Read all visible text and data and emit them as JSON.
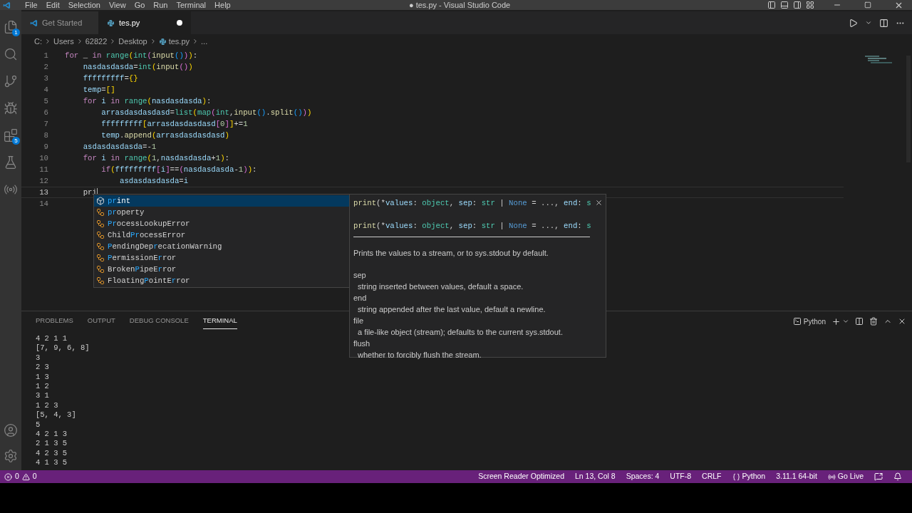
{
  "menu": [
    "File",
    "Edit",
    "Selection",
    "View",
    "Go",
    "Run",
    "Terminal",
    "Help"
  ],
  "window": {
    "title": "● tes.py - Visual Studio Code"
  },
  "activity_badges": {
    "explorer": "1",
    "extensions": "5"
  },
  "tabs": [
    {
      "label": "Get Started",
      "kind": "welcome",
      "selected": false,
      "modified": false
    },
    {
      "label": "tes.py",
      "kind": "python",
      "selected": true,
      "modified": true
    }
  ],
  "breadcrumb": [
    "C:",
    "Users",
    "62822",
    "Desktop",
    "tes.py",
    "..."
  ],
  "code_lines": [
    {
      "number": "1",
      "current": false,
      "tokens": [
        {
          "t": "for",
          "kind": "kw"
        },
        {
          "t": " _ ",
          "kind": "op"
        },
        {
          "t": "in ",
          "kind": "kw"
        },
        {
          "t": "range",
          "kind": "cls"
        },
        {
          "t": "(",
          "kind": "b1"
        },
        {
          "t": "int",
          "kind": "cls"
        },
        {
          "t": "(",
          "kind": "b2"
        },
        {
          "t": "input",
          "kind": "fn"
        },
        {
          "t": "()",
          "kind": "b3"
        },
        {
          "t": ")",
          "kind": "b2"
        },
        {
          "t": ")",
          "kind": "b1"
        },
        {
          "t": ":",
          "kind": "op"
        }
      ]
    },
    {
      "number": "2",
      "current": false,
      "tokens": [
        {
          "t": "    nasdasdasda",
          "kind": "var"
        },
        {
          "t": "=",
          "kind": "op"
        },
        {
          "t": "int",
          "kind": "cls"
        },
        {
          "t": "(",
          "kind": "b1"
        },
        {
          "t": "input",
          "kind": "fn"
        },
        {
          "t": "()",
          "kind": "b2"
        },
        {
          "t": ")",
          "kind": "b1"
        }
      ]
    },
    {
      "number": "3",
      "current": false,
      "tokens": [
        {
          "t": "    fffffffff",
          "kind": "var"
        },
        {
          "t": "=",
          "kind": "op"
        },
        {
          "t": "{}",
          "kind": "b1"
        }
      ]
    },
    {
      "number": "4",
      "current": false,
      "tokens": [
        {
          "t": "    temp",
          "kind": "var"
        },
        {
          "t": "=",
          "kind": "op"
        },
        {
          "t": "[]",
          "kind": "b1"
        }
      ]
    },
    {
      "number": "5",
      "current": false,
      "tokens": [
        {
          "t": "    for",
          "kind": "kw"
        },
        {
          "t": " i ",
          "kind": "var"
        },
        {
          "t": "in ",
          "kind": "kw"
        },
        {
          "t": "range",
          "kind": "cls"
        },
        {
          "t": "(",
          "kind": "b1"
        },
        {
          "t": "nasdasdasda",
          "kind": "var"
        },
        {
          "t": ")",
          "kind": "b1"
        },
        {
          "t": ":",
          "kind": "op"
        }
      ]
    },
    {
      "number": "6",
      "current": false,
      "tokens": [
        {
          "t": "        arrasdasdasdasd",
          "kind": "var"
        },
        {
          "t": "=",
          "kind": "op"
        },
        {
          "t": "list",
          "kind": "cls"
        },
        {
          "t": "(",
          "kind": "b1"
        },
        {
          "t": "map",
          "kind": "cls"
        },
        {
          "t": "(",
          "kind": "b2"
        },
        {
          "t": "int",
          "kind": "cls"
        },
        {
          "t": ",",
          "kind": "op"
        },
        {
          "t": "input",
          "kind": "fn"
        },
        {
          "t": "()",
          "kind": "b3"
        },
        {
          "t": ".",
          "kind": "op"
        },
        {
          "t": "split",
          "kind": "fn"
        },
        {
          "t": "()",
          "kind": "b3"
        },
        {
          "t": ")",
          "kind": "b2"
        },
        {
          "t": ")",
          "kind": "b1"
        }
      ]
    },
    {
      "number": "7",
      "current": false,
      "tokens": [
        {
          "t": "        fffffffff",
          "kind": "var"
        },
        {
          "t": "[",
          "kind": "b1"
        },
        {
          "t": "arrasdasdasdasd",
          "kind": "var"
        },
        {
          "t": "[",
          "kind": "b2"
        },
        {
          "t": "0",
          "kind": "num"
        },
        {
          "t": "]",
          "kind": "b2"
        },
        {
          "t": "]",
          "kind": "b1"
        },
        {
          "t": "+=",
          "kind": "op"
        },
        {
          "t": "1",
          "kind": "num"
        }
      ]
    },
    {
      "number": "8",
      "current": false,
      "tokens": [
        {
          "t": "        temp",
          "kind": "var"
        },
        {
          "t": ".",
          "kind": "op"
        },
        {
          "t": "append",
          "kind": "fn"
        },
        {
          "t": "(",
          "kind": "b1"
        },
        {
          "t": "arrasdasdasdasd",
          "kind": "var"
        },
        {
          "t": ")",
          "kind": "b1"
        }
      ]
    },
    {
      "number": "9",
      "current": false,
      "tokens": [
        {
          "t": "    asdasdasdasda",
          "kind": "var"
        },
        {
          "t": "=-",
          "kind": "op"
        },
        {
          "t": "1",
          "kind": "num"
        }
      ]
    },
    {
      "number": "10",
      "current": false,
      "tokens": [
        {
          "t": "    for",
          "kind": "kw"
        },
        {
          "t": " i ",
          "kind": "var"
        },
        {
          "t": "in ",
          "kind": "kw"
        },
        {
          "t": "range",
          "kind": "cls"
        },
        {
          "t": "(",
          "kind": "b1"
        },
        {
          "t": "1",
          "kind": "num"
        },
        {
          "t": ",",
          "kind": "op"
        },
        {
          "t": "nasdasdasda",
          "kind": "var"
        },
        {
          "t": "+",
          "kind": "op"
        },
        {
          "t": "1",
          "kind": "num"
        },
        {
          "t": ")",
          "kind": "b1"
        },
        {
          "t": ":",
          "kind": "op"
        }
      ]
    },
    {
      "number": "11",
      "current": false,
      "tokens": [
        {
          "t": "        if",
          "kind": "kw"
        },
        {
          "t": "(",
          "kind": "b1"
        },
        {
          "t": "fffffffff",
          "kind": "var"
        },
        {
          "t": "[",
          "kind": "b2"
        },
        {
          "t": "i",
          "kind": "var"
        },
        {
          "t": "]",
          "kind": "b2"
        },
        {
          "t": "==",
          "kind": "op"
        },
        {
          "t": "(",
          "kind": "b2"
        },
        {
          "t": "nasdasdasda",
          "kind": "var"
        },
        {
          "t": "-",
          "kind": "op"
        },
        {
          "t": "1",
          "kind": "num"
        },
        {
          "t": ")",
          "kind": "b2"
        },
        {
          "t": ")",
          "kind": "b1"
        },
        {
          "t": ":",
          "kind": "op"
        }
      ]
    },
    {
      "number": "12",
      "current": false,
      "tokens": [
        {
          "t": "            asdasdasdasda",
          "kind": "var"
        },
        {
          "t": "=",
          "kind": "op"
        },
        {
          "t": "i",
          "kind": "var"
        }
      ]
    },
    {
      "number": "13",
      "current": true,
      "tokens": [
        {
          "t": "    pri",
          "kind": "op"
        }
      ]
    },
    {
      "number": "14",
      "current": false
    }
  ],
  "suggestions": [
    {
      "kind": "method",
      "selected": true,
      "parts": [
        {
          "t": "pr",
          "match": true
        },
        {
          "t": "int",
          "match": false
        }
      ]
    },
    {
      "kind": "class",
      "selected": false,
      "parts": [
        {
          "t": "pr",
          "match": true
        },
        {
          "t": "operty",
          "match": false
        }
      ]
    },
    {
      "kind": "class",
      "selected": false,
      "parts": [
        {
          "t": "Pr",
          "match": true
        },
        {
          "t": "ocessLookupError",
          "match": false
        }
      ]
    },
    {
      "kind": "class",
      "selected": false,
      "parts": [
        {
          "t": "Child",
          "match": false
        },
        {
          "t": "Pr",
          "match": true
        },
        {
          "t": "ocessError",
          "match": false
        }
      ]
    },
    {
      "kind": "class",
      "selected": false,
      "parts": [
        {
          "t": "P",
          "match": true
        },
        {
          "t": "endingDep",
          "match": false
        },
        {
          "t": "r",
          "match": true
        },
        {
          "t": "ecationWarning",
          "match": false
        }
      ]
    },
    {
      "kind": "class",
      "selected": false,
      "parts": [
        {
          "t": "P",
          "match": true
        },
        {
          "t": "ermissionE",
          "match": false
        },
        {
          "t": "r",
          "match": true
        },
        {
          "t": "ror",
          "match": false
        }
      ]
    },
    {
      "kind": "class",
      "selected": false,
      "parts": [
        {
          "t": "Broken",
          "match": false
        },
        {
          "t": "P",
          "match": true
        },
        {
          "t": "ipeE",
          "match": false
        },
        {
          "t": "r",
          "match": true
        },
        {
          "t": "ror",
          "match": false
        }
      ]
    },
    {
      "kind": "class",
      "selected": false,
      "parts": [
        {
          "t": "Floating",
          "match": false
        },
        {
          "t": "P",
          "match": true
        },
        {
          "t": "ointE",
          "match": false
        },
        {
          "t": "r",
          "match": true
        },
        {
          "t": "ror",
          "match": false
        }
      ]
    }
  ],
  "hover": {
    "signatures": [
      [
        {
          "t": "print",
          "kind": "fn"
        },
        {
          "t": "(*",
          "kind": "op"
        },
        {
          "t": "values",
          "kind": "var"
        },
        {
          "t": ":",
          "kind": "op"
        },
        {
          "t": " object",
          "kind": "cls"
        },
        {
          "t": ",",
          "kind": "op"
        },
        {
          "t": " sep",
          "kind": "var"
        },
        {
          "t": ":",
          "kind": "op"
        },
        {
          "t": " str",
          "kind": "cls"
        },
        {
          "t": " |",
          "kind": "op"
        },
        {
          "t": " None",
          "kind": "const"
        },
        {
          "t": " = ...,",
          "kind": "op"
        },
        {
          "t": " end",
          "kind": "var"
        },
        {
          "t": ":",
          "kind": "op"
        },
        {
          "t": " s",
          "kind": "cls"
        }
      ],
      [
        {
          "t": "print",
          "kind": "fn"
        },
        {
          "t": "(*",
          "kind": "op"
        },
        {
          "t": "values",
          "kind": "var"
        },
        {
          "t": ":",
          "kind": "op"
        },
        {
          "t": " object",
          "kind": "cls"
        },
        {
          "t": ",",
          "kind": "op"
        },
        {
          "t": " sep",
          "kind": "var"
        },
        {
          "t": ":",
          "kind": "op"
        },
        {
          "t": " str",
          "kind": "cls"
        },
        {
          "t": " |",
          "kind": "op"
        },
        {
          "t": " None",
          "kind": "const"
        },
        {
          "t": " = ...,",
          "kind": "op"
        },
        {
          "t": " end",
          "kind": "var"
        },
        {
          "t": ":",
          "kind": "op"
        },
        {
          "t": " s",
          "kind": "cls"
        }
      ]
    ],
    "summary": "Prints the values to a stream, or to sys.stdout by default.",
    "params": [
      {
        "name": "sep",
        "text": "string inserted between values, default a space."
      },
      {
        "name": "end",
        "text": "string appended after the last value, default a newline."
      },
      {
        "name": "file",
        "text": "a file-like object (stream); defaults to the current sys.stdout."
      },
      {
        "name": "flush",
        "text": "whether to forcibly flush the stream."
      }
    ]
  },
  "panel": {
    "tabs": [
      {
        "label": "PROBLEMS",
        "selected": false
      },
      {
        "label": "OUTPUT",
        "selected": false
      },
      {
        "label": "DEBUG CONSOLE",
        "selected": false
      },
      {
        "label": "TERMINAL",
        "selected": true
      }
    ],
    "terminal_kind": "Python",
    "terminal_lines": [
      "4 2 1 1",
      "[7, 9, 6, 8]",
      "3",
      "2 3",
      "1 3",
      "1 2",
      "3 1",
      "1 2 3",
      "[5, 4, 3]",
      "5",
      "4 2 1 3",
      "2 1 3 5",
      "4 2 3 5",
      "4 1 3 5"
    ]
  },
  "status_bar": {
    "errors": "0",
    "warnings": "0",
    "items": [
      "Screen Reader Optimized",
      "Ln 13, Col 8",
      "Spaces: 4",
      "UTF-8",
      "CRLF"
    ],
    "language": "Python",
    "interpreter": "3.11.1 64-bit",
    "live": "Go Live"
  }
}
